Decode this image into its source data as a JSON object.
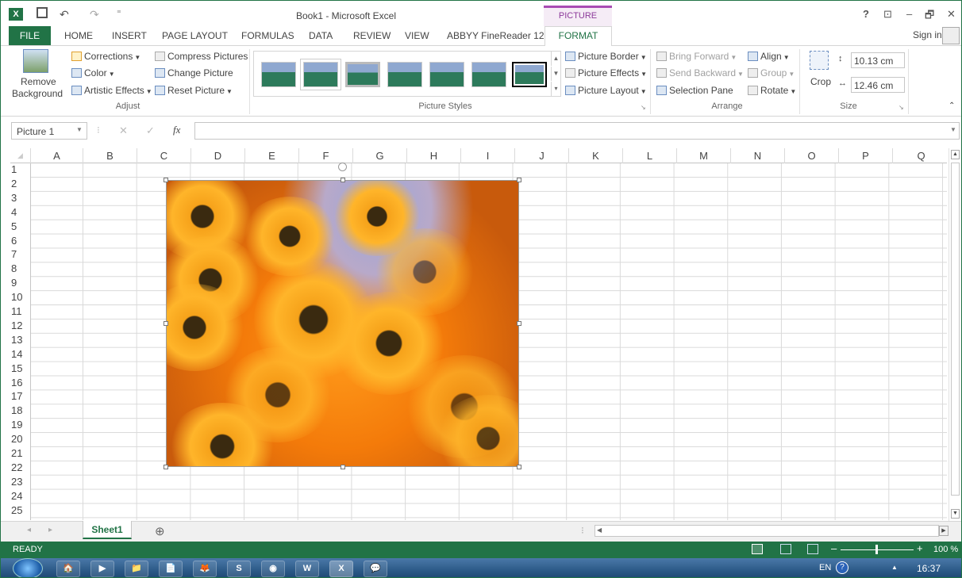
{
  "window": {
    "title": "Book1 - Microsoft Excel",
    "context_tab": "PICTURE TOOLS",
    "buttons": {
      "help": "?",
      "ribbon_opts": "⊡",
      "minimize": "–",
      "restore": "🗗",
      "close": "✕"
    }
  },
  "qat": {
    "undo": "↶",
    "redo": "↷",
    "customize": "⁼"
  },
  "tabs": [
    "HOME",
    "INSERT",
    "PAGE LAYOUT",
    "FORMULAS",
    "DATA",
    "REVIEW",
    "VIEW",
    "ABBYY FineReader 12"
  ],
  "file_tab": "FILE",
  "format_tab": "FORMAT",
  "signin": "Sign in",
  "ribbon": {
    "adjust": {
      "remove_bg_1": "Remove",
      "remove_bg_2": "Background",
      "corrections": "Corrections",
      "color": "Color",
      "artistic": "Artistic Effects",
      "compress": "Compress Pictures",
      "change": "Change Picture",
      "reset": "Reset Picture",
      "label": "Adjust"
    },
    "styles": {
      "border": "Picture Border",
      "effects": "Picture Effects",
      "layout": "Picture Layout",
      "label": "Picture Styles"
    },
    "arrange": {
      "bring": "Bring Forward",
      "send": "Send Backward",
      "pane": "Selection Pane",
      "align": "Align",
      "group": "Group",
      "rotate": "Rotate",
      "label": "Arrange"
    },
    "size": {
      "crop": "Crop",
      "height": "10.13 cm",
      "width": "12.46 cm",
      "label": "Size"
    }
  },
  "formula": {
    "name_box": "Picture 1",
    "fx": "fx",
    "cancel": "✕",
    "enter": "✓",
    "value": ""
  },
  "columns": [
    "A",
    "B",
    "C",
    "D",
    "E",
    "F",
    "G",
    "H",
    "I",
    "J",
    "K",
    "L",
    "M",
    "N",
    "O",
    "P",
    "Q"
  ],
  "rows": [
    "1",
    "2",
    "3",
    "4",
    "5",
    "6",
    "7",
    "8",
    "9",
    "10",
    "11",
    "12",
    "13",
    "14",
    "15",
    "16",
    "17",
    "18",
    "19",
    "20",
    "21",
    "22",
    "23",
    "24",
    "25"
  ],
  "sheet": {
    "name": "Sheet1",
    "add": "⊕"
  },
  "status": {
    "ready": "READY",
    "zoom": "100 %",
    "minus": "–",
    "plus": "+"
  },
  "taskbar": {
    "lang": "EN",
    "time": "16:37",
    "apps": [
      "🏠",
      "▶",
      "📁",
      "📄",
      "🦊",
      "S",
      "◉",
      "W",
      "X",
      "💬"
    ]
  }
}
